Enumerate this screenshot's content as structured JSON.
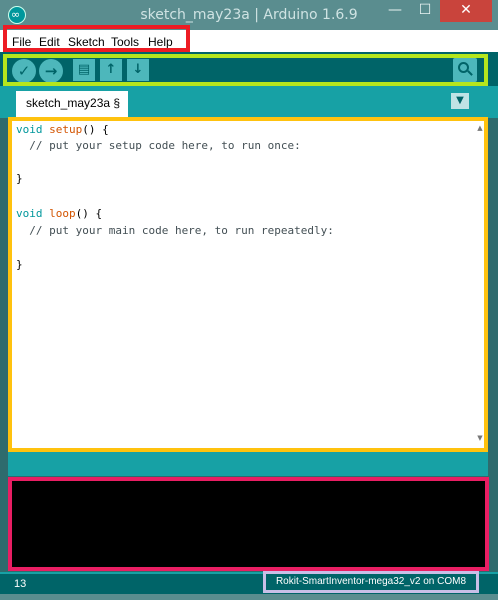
{
  "window": {
    "title": "sketch_may23a | Arduino 1.6.9",
    "icons": {
      "app": "arduino-infinity-icon",
      "minimize": "minimize-icon",
      "maximize": "maximize-icon",
      "close": "close-icon"
    },
    "minimize_glyph": "—",
    "maximize_glyph": "☐",
    "close_glyph": "✕",
    "app_glyph": "∞"
  },
  "menu": {
    "items": [
      {
        "label": "File"
      },
      {
        "label": "Edit"
      },
      {
        "label": "Sketch"
      },
      {
        "label": "Tools"
      },
      {
        "label": "Help"
      }
    ]
  },
  "toolbar": {
    "verify_glyph": "✓",
    "upload_glyph": "→",
    "new_glyph": "▤",
    "open_glyph": "↑",
    "save_glyph": "↓",
    "icons": [
      "verify-icon",
      "upload-icon",
      "new-sketch-icon",
      "open-icon",
      "save-icon",
      "serial-monitor-icon"
    ]
  },
  "tabs": {
    "items": [
      {
        "label": "sketch_may23a §"
      }
    ],
    "menu_glyph": "▼"
  },
  "editor": {
    "lines": [
      {
        "kw": "void",
        "fn": "setup",
        "rest": "() {"
      },
      {
        "comment": "  // put your setup code here, to run once:"
      },
      {
        "plain": ""
      },
      {
        "plain": "}"
      },
      {
        "plain": ""
      },
      {
        "kw": "void",
        "fn": "loop",
        "rest": "() {"
      },
      {
        "comment": "  // put your main code here, to run repeatedly:"
      },
      {
        "plain": ""
      },
      {
        "plain": "}"
      }
    ]
  },
  "status": {
    "line_number": "13",
    "board": "Rokit-SmartInventor-mega32_v2 on COM8"
  },
  "colors": {
    "teal_dark": "#006468",
    "teal": "#17a1a5",
    "teal_light": "#4db7bb",
    "highlight_menu": "#ed1c24",
    "highlight_toolbar": "#b5e61d",
    "highlight_editor": "#ffc20e",
    "highlight_console": "#e91e63",
    "highlight_board": "#c8bfe7"
  }
}
